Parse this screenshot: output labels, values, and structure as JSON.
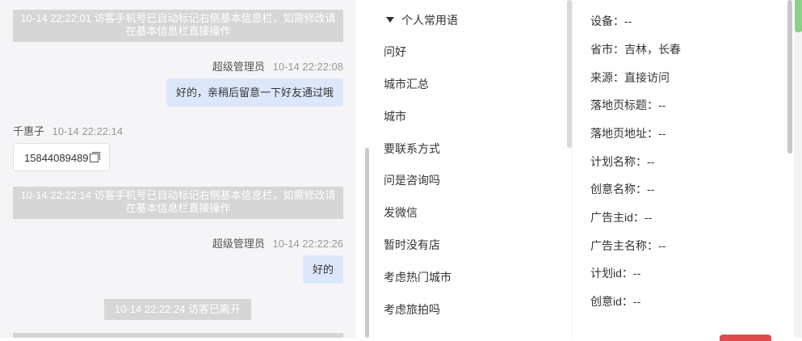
{
  "chat": {
    "messages": [
      {
        "type": "system",
        "text": "10-14 22:22:01 访客手机号已自动标记右侧基本信息栏，如需修改请在基本信息栏直接操作"
      },
      {
        "type": "agent",
        "sender": "超级管理员",
        "time": "10-14 22:22:08",
        "text": "好的，亲稍后留意一下好友通过哦"
      },
      {
        "type": "visitor",
        "sender": "千惠子",
        "time": "10-14 22:22:14",
        "text": "15844089489"
      },
      {
        "type": "system",
        "text": "10-14 22:22:14 访客手机号已自动标记右侧基本信息栏，如需修改请在基本信息栏直接操作"
      },
      {
        "type": "agent",
        "sender": "超级管理员",
        "time": "10-14 22:22:26",
        "text": "好的"
      },
      {
        "type": "system",
        "text": "10-14 22:22:24 访客已离开"
      }
    ]
  },
  "phrases": {
    "header": "个人常用语",
    "items": [
      "问好",
      "城市汇总",
      "城市",
      "要联系方式",
      "问是咨询吗",
      "发微信",
      "暂时没有店",
      "考虑热门城市",
      "考虑旅拍吗"
    ]
  },
  "info": {
    "rows": [
      {
        "label": "设备：",
        "value": "--"
      },
      {
        "label": "省市：",
        "value": "吉林，长春"
      },
      {
        "label": "来源：",
        "value": "直接访问"
      },
      {
        "label": "落地页标题：",
        "value": "--"
      },
      {
        "label": "落地页地址：",
        "value": "--"
      },
      {
        "label": "计划名称：",
        "value": "--"
      },
      {
        "label": "创意名称：",
        "value": "--"
      },
      {
        "label": "广告主id：",
        "value": "--"
      },
      {
        "label": "广告主名称：",
        "value": "--"
      },
      {
        "label": "计划id：",
        "value": "--"
      },
      {
        "label": "创意id：",
        "value": "--"
      }
    ]
  },
  "colors": {
    "agent_bubble": "#dde7fb",
    "system_notice": "#d6d6d6",
    "chat_bg": "#f5f5f7"
  },
  "icons": {
    "copy": "copy-icon",
    "collapse": "caret-down-icon"
  }
}
